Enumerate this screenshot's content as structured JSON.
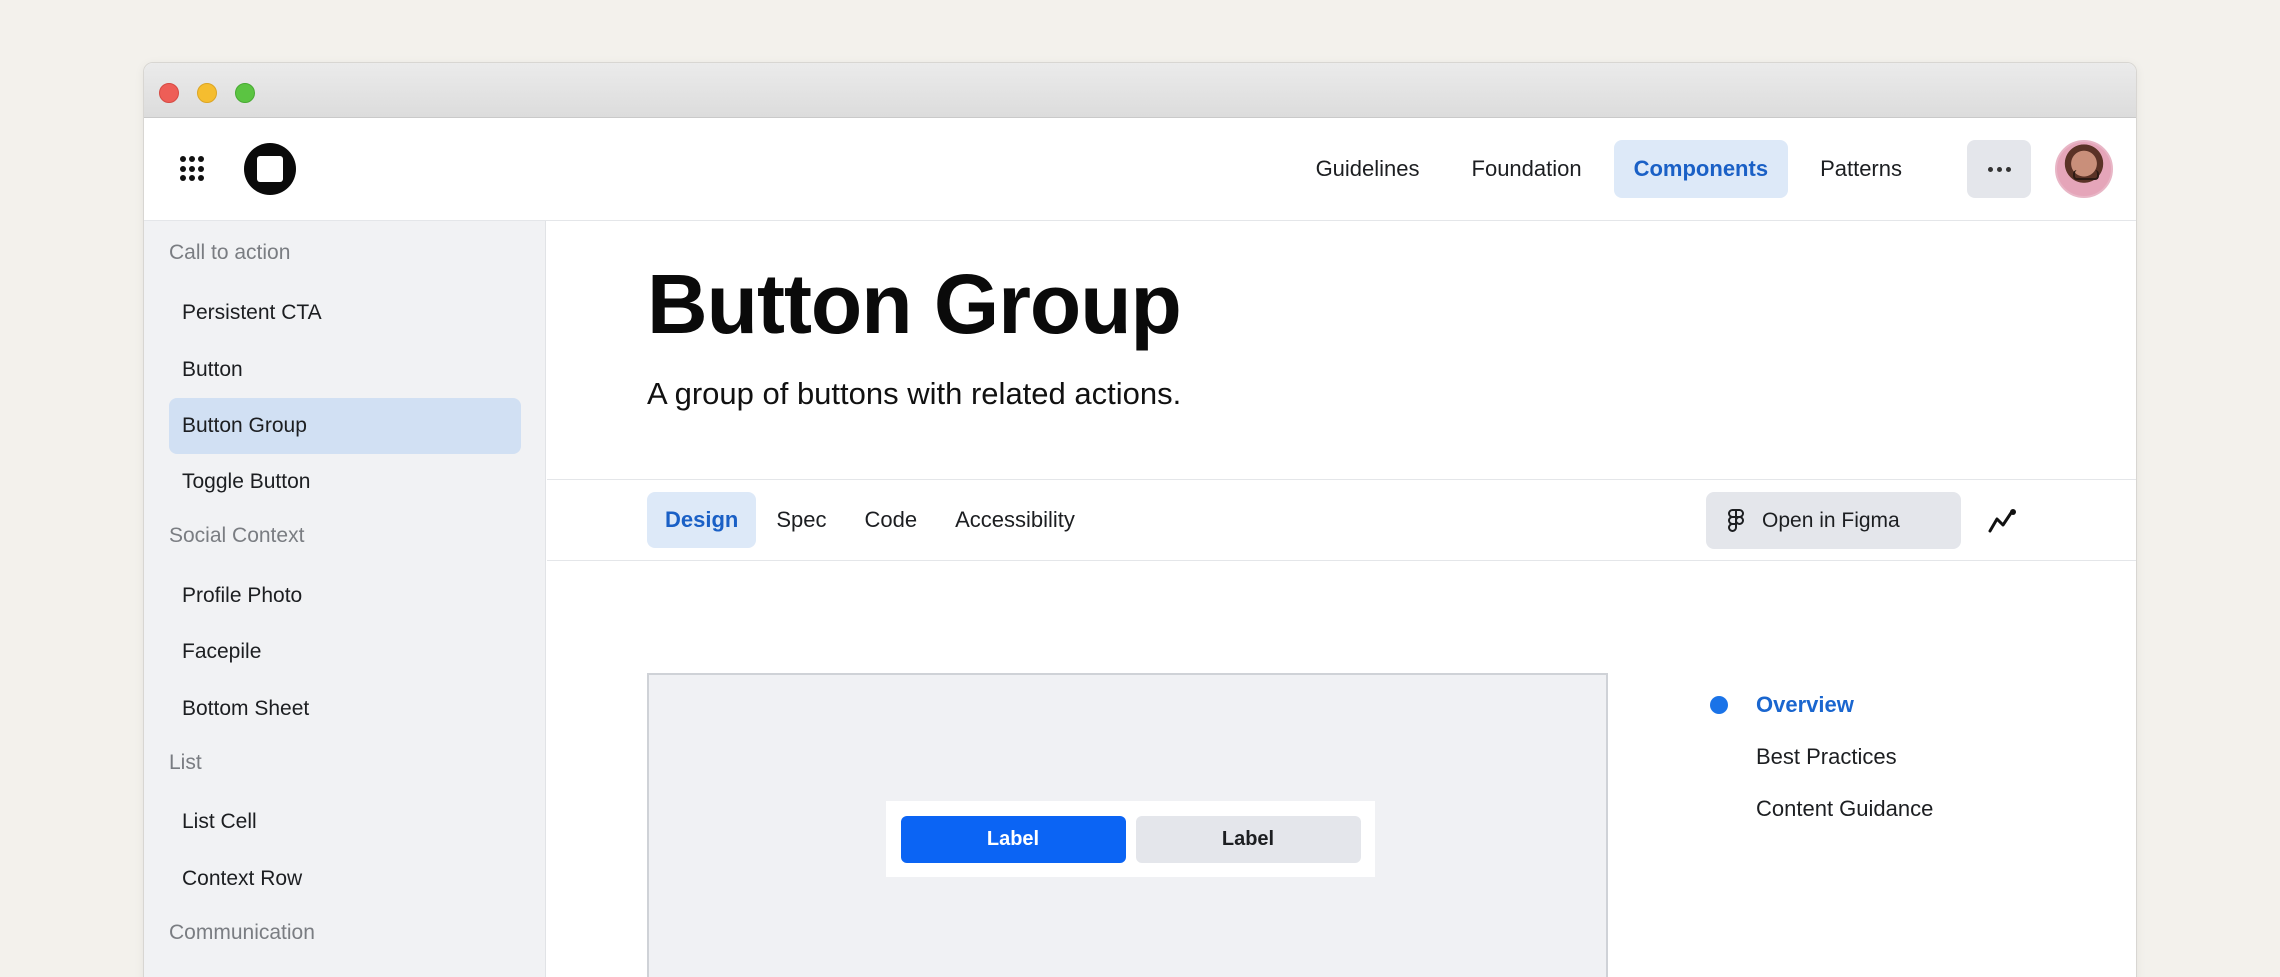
{
  "nav": {
    "links": [
      "Guidelines",
      "Foundation",
      "Components",
      "Patterns"
    ],
    "active": "Components",
    "more_icon": "more-horizontal-icon",
    "grid_icon": "apps-grid-icon"
  },
  "sidebar": {
    "sections": [
      {
        "heading": "Call to action",
        "items": [
          "Persistent CTA",
          "Button",
          "Button Group",
          "Toggle Button"
        ]
      },
      {
        "heading": "Social Context",
        "items": [
          "Profile Photo",
          "Facepile",
          "Bottom Sheet"
        ]
      },
      {
        "heading": "List",
        "items": [
          "List Cell",
          "Context Row"
        ]
      },
      {
        "heading": "Communication",
        "items": []
      }
    ],
    "active": "Button Group"
  },
  "page": {
    "title": "Button Group",
    "subtitle": "A group of buttons with related actions."
  },
  "tabs": {
    "items": [
      "Design",
      "Spec",
      "Code",
      "Accessibility"
    ],
    "active": "Design",
    "figma_label": "Open in Figma"
  },
  "preview": {
    "primary_label": "Label",
    "secondary_label": "Label"
  },
  "toc": {
    "items": [
      "Overview",
      "Best Practices",
      "Content Guidance"
    ],
    "active": "Overview"
  },
  "colors": {
    "accent": "#1a60c6",
    "accent_bg": "#dde9f8",
    "primary_button": "#0b64f4"
  }
}
